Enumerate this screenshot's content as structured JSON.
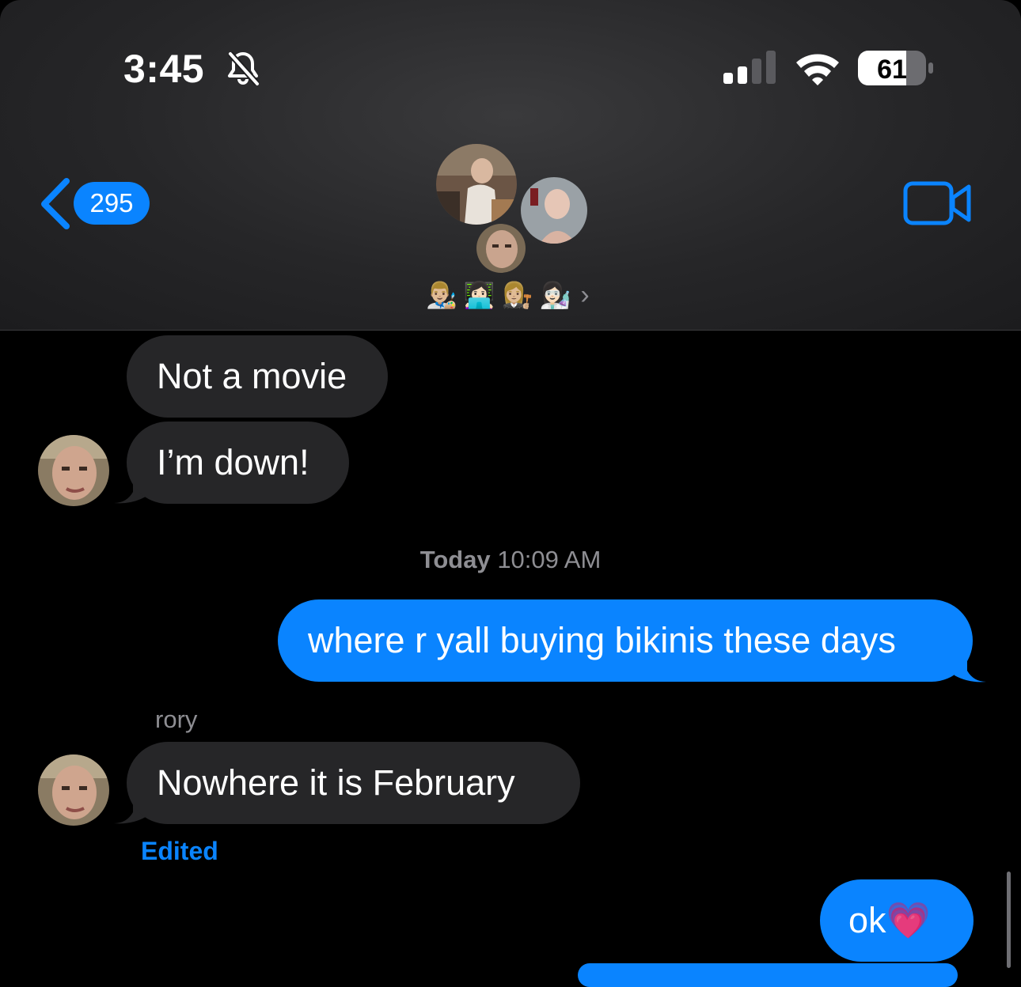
{
  "status_bar": {
    "time": "3:45",
    "battery": "61",
    "icons": [
      "bell-slash-icon",
      "cellular-signal-icon",
      "wifi-icon",
      "battery-icon"
    ]
  },
  "nav": {
    "back_count": "295",
    "member_emojis": [
      "👨🏼‍🎨",
      "👩🏻‍💻",
      "👩🏼‍⚖️",
      "👩🏻‍🔬"
    ],
    "more_chevron": "›",
    "video_icon": "video-camera-icon"
  },
  "messages": {
    "msg1": "Not a movie",
    "msg2": "I’m down!",
    "timestamp_day": "Today",
    "timestamp_time": "10:09 AM",
    "msg3": "where r yall buying bikinis these days",
    "sender": "rory",
    "msg4": "Nowhere it is February",
    "edited_label": "Edited",
    "msg5": "ok💗"
  },
  "colors": {
    "accent": "#0a84ff",
    "incoming": "#262628",
    "background": "#000000"
  }
}
